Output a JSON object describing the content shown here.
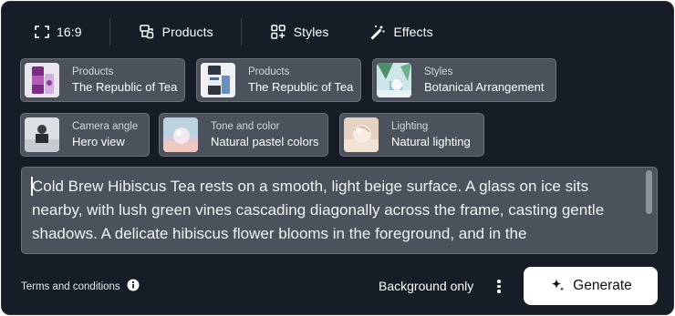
{
  "toolbar": {
    "aspect_ratio": "16:9",
    "products_label": "Products",
    "styles_label": "Styles",
    "effects_label": "Effects"
  },
  "chips": [
    {
      "category": "Products",
      "value": "The Republic of Tea",
      "thumb": "tea-tin-purple"
    },
    {
      "category": "Products",
      "value": "The Republic of Tea",
      "thumb": "tea-tin-blue"
    },
    {
      "category": "Styles",
      "value": "Botanical Arrangement",
      "thumb": "botanical"
    },
    {
      "category": "Camera angle",
      "value": "Hero view",
      "thumb": "hero-view"
    },
    {
      "category": "Tone and color",
      "value": "Natural pastel colors",
      "thumb": "pastel"
    },
    {
      "category": "Lighting",
      "value": "Natural lighting",
      "thumb": "lighting"
    }
  ],
  "prompt": {
    "text": "Cold Brew Hibiscus Tea rests on a smooth, light beige surface. A glass on ice sits nearby, with lush green vines cascading diagonally across the frame, casting gentle shadows. A delicate hibiscus flower blooms in the foreground, and in the"
  },
  "footer": {
    "terms_label": "Terms and conditions",
    "background_only_label": "Background only",
    "generate_label": "Generate"
  }
}
